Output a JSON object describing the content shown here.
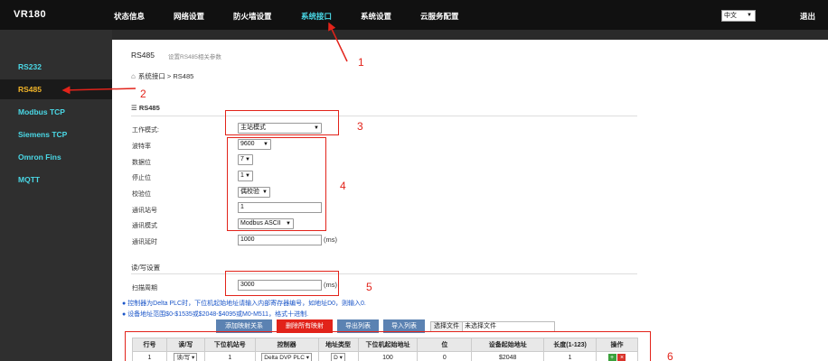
{
  "brand": "VR180",
  "nav": {
    "items": [
      "状态信息",
      "网络设置",
      "防火墙设置",
      "系统接口",
      "系统设置",
      "云服务配置"
    ],
    "active": "系统接口",
    "language": "中文",
    "logout": "退出"
  },
  "sidebar": {
    "items": [
      "RS232",
      "RS485",
      "Modbus TCP",
      "Siemens TCP",
      "Omron Fins",
      "MQTT"
    ],
    "active": "RS485"
  },
  "page": {
    "title": "RS485",
    "subtitle": "设置RS485相关参数",
    "breadcrumb": "系统接口 > RS485"
  },
  "rs485": {
    "section_title": "RS485",
    "work_mode_label": "工作模式:",
    "work_mode": "主站模式",
    "baud_label": "波特率",
    "baud": "9600",
    "databits_label": "数据位",
    "databits": "7",
    "stopbits_label": "停止位",
    "stopbits": "1",
    "parity_label": "校验位",
    "parity": "偶校验",
    "station_label": "通讯站号",
    "station": "1",
    "mode_label": "通讯模式",
    "mode": "Modbus ASCII",
    "delay_label": "通讯延时",
    "delay": "1000",
    "delay_unit": "(ms)"
  },
  "rw": {
    "section_title": "读/写设置",
    "scan_label": "扫描周期",
    "scan": "3000",
    "scan_unit": "(ms)",
    "notes": [
      "控制器为Delta PLC时，下位机起始地址请输入内部寄存器编号，如地址D0，则输入0.",
      "设备地址范围$0-$1535或$2048-$4095或M0-M511，格式十进制."
    ]
  },
  "actions": {
    "add_mapping": "添加映射关系",
    "delete_all": "删除所有映射",
    "export": "导出列表",
    "import": "导入列表",
    "choose_file": "选择文件",
    "no_file": "未选择文件"
  },
  "table": {
    "headers": [
      "行号",
      "读/写",
      "下位机站号",
      "控制器",
      "地址类型",
      "下位机起始地址",
      "位",
      "设备起始地址",
      "长度(1-123)",
      "操作"
    ],
    "rows": [
      {
        "row": "1",
        "rw": "读/写",
        "station": "1",
        "controller": "Delta DVP PLC",
        "addr_type": "D",
        "start_addr": "100",
        "bit": "0",
        "dev_addr": "$2048",
        "length": "1"
      }
    ]
  },
  "annotations": [
    "1",
    "2",
    "3",
    "4",
    "5",
    "6"
  ],
  "colors": {
    "accent": "#4ad8e6",
    "active_side": "#f0b429",
    "annotation": "#e2231a",
    "note": "#1a55c8"
  }
}
